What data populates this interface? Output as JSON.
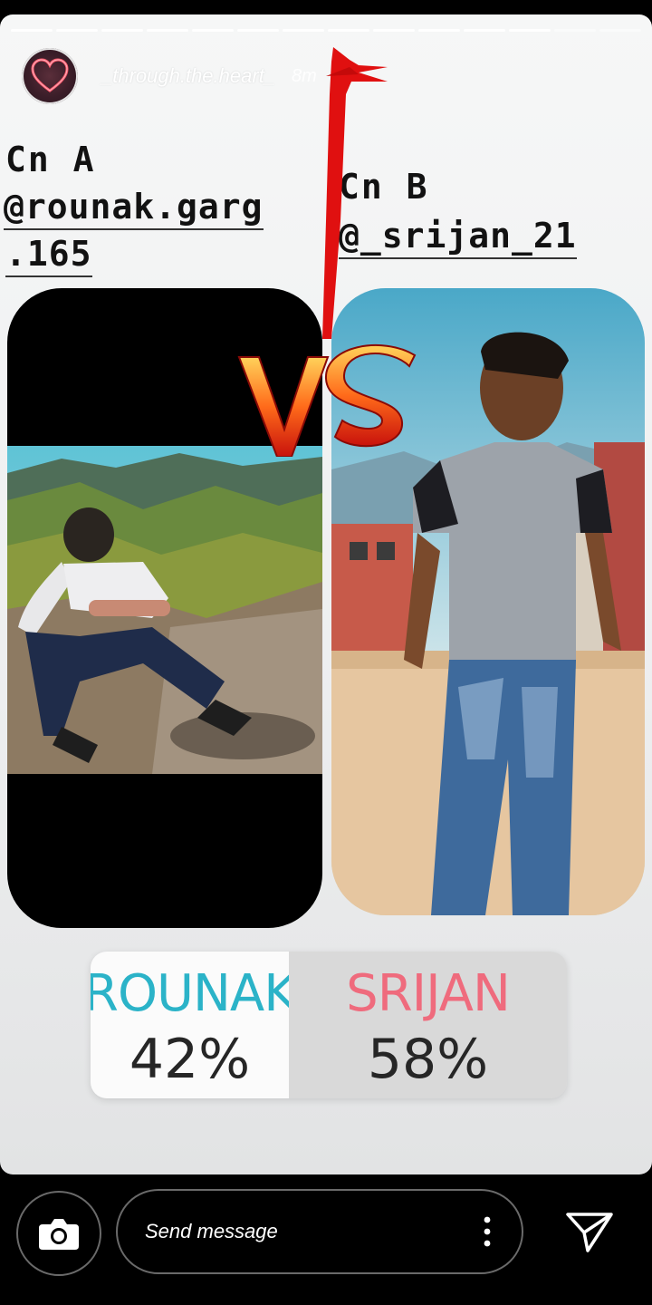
{
  "story": {
    "progress_segments": 14,
    "progress_done": 12,
    "username": "_through.the.heart_",
    "time": "8m"
  },
  "contestant_a": {
    "title": "Cn A",
    "handle_line1": "@rounak.garg",
    "handle_line2": ".165"
  },
  "contestant_b": {
    "title": "Cn B",
    "handle": "@_srijan_21"
  },
  "poll": {
    "option_a": {
      "name": "ROUNAK",
      "percent": "42%"
    },
    "option_b": {
      "name": "SRIJAN",
      "percent": "58%"
    },
    "share_a": 0.42
  },
  "composer": {
    "placeholder": "Send message"
  },
  "icons": {
    "avatar": "heart-icon",
    "camera": "camera-icon",
    "more": "more-vertical-icon",
    "send": "send-icon"
  },
  "colors": {
    "rounak": "#2bb3c8",
    "srijan": "#ef6b7d"
  }
}
